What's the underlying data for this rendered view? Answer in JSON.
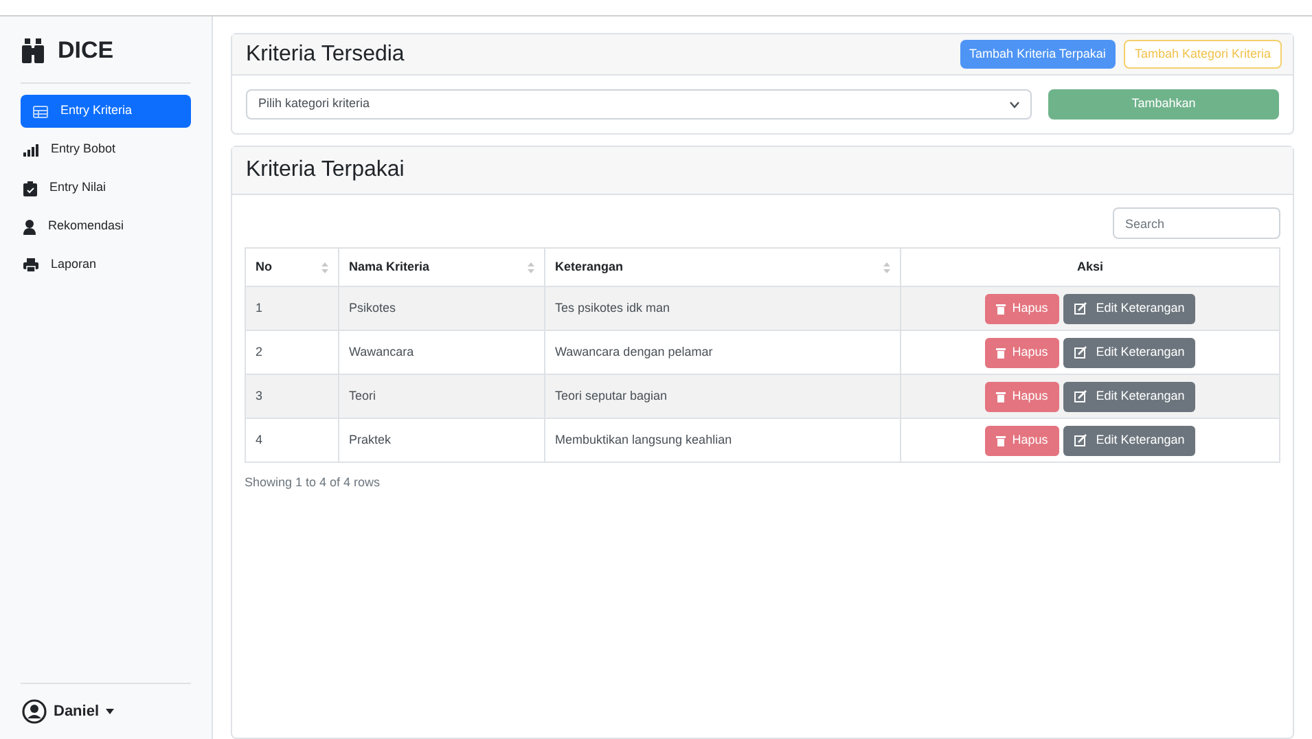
{
  "sidebar": {
    "brand": "DICE",
    "items": [
      {
        "label": "Entry Kriteria",
        "selected": true
      },
      {
        "label": "Entry Bobot",
        "selected": false
      },
      {
        "label": "Entry Nilai",
        "selected": false
      },
      {
        "label": "Rekomendasi",
        "selected": false
      },
      {
        "label": "Laporan",
        "selected": false
      }
    ],
    "user": "Daniel"
  },
  "available": {
    "title": "Kriteria Tersedia",
    "buttons": [
      {
        "label": "Tambah Kriteria Terpakai",
        "kind": "primary"
      },
      {
        "label": "Tambah Kategori Kriteria",
        "kind": "warning-outline"
      }
    ],
    "select": {
      "placeholder": "Pilih kategori kriteria"
    },
    "add_button": "Tambahkan"
  },
  "used": {
    "title": "Kriteria Terpakai",
    "search": {
      "placeholder": "Search"
    },
    "table": {
      "columns": [
        {
          "label": "No",
          "sortable": true
        },
        {
          "label": "Nama Kriteria",
          "sortable": true
        },
        {
          "label": "Keterangan",
          "sortable": true
        },
        {
          "label": "Aksi",
          "sortable": false
        }
      ],
      "rows": [
        {
          "no": "1",
          "name": "Psikotes",
          "note": "Tes psikotes idk man",
          "actions": [
            "Hapus",
            "Edit Keterangan"
          ]
        },
        {
          "no": "2",
          "name": "Wawancara",
          "note": "Wawancara dengan pelamar",
          "actions": [
            "Hapus",
            "Edit Keterangan"
          ]
        },
        {
          "no": "3",
          "name": "Teori",
          "note": "Teori seputar bagian",
          "actions": [
            "Hapus",
            "Edit Keterangan"
          ]
        },
        {
          "no": "4",
          "name": "Praktek",
          "note": "Membuktikan langsung keahlian",
          "actions": [
            "Hapus",
            "Edit Keterangan"
          ]
        }
      ]
    },
    "footer": "Showing 1 to 4 of 4 rows"
  }
}
